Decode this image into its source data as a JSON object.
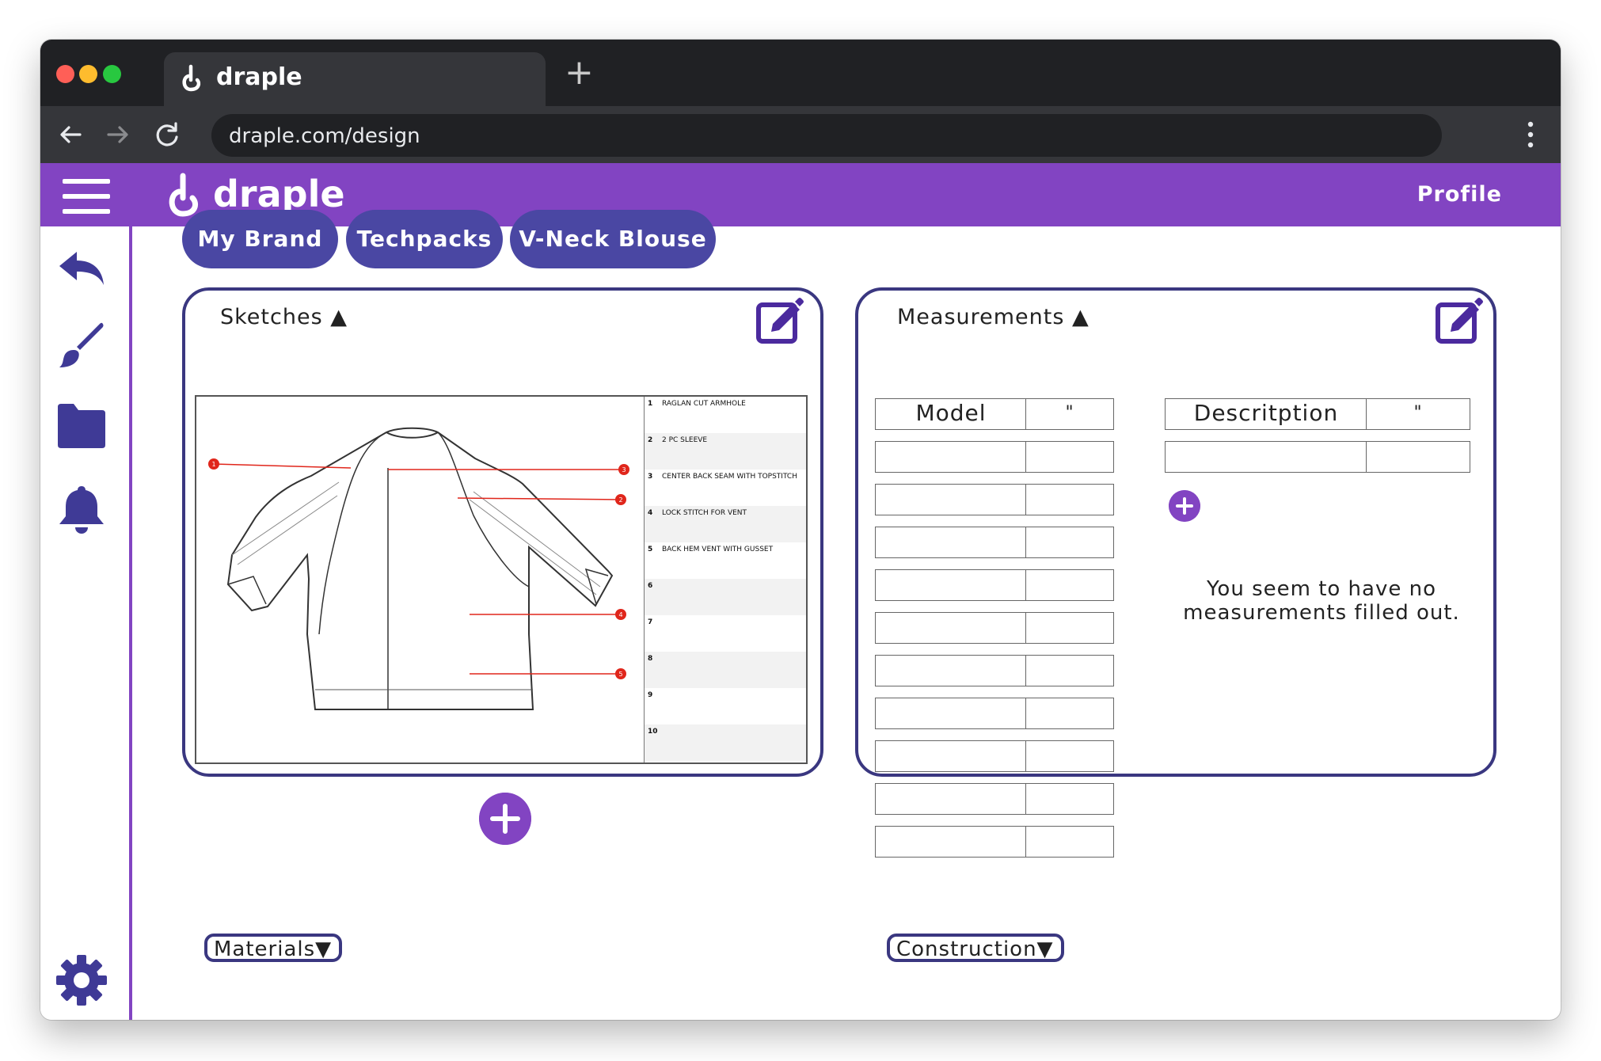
{
  "browser": {
    "tab_title": "draple",
    "new_tab_label": "+",
    "url": "draple.com/design"
  },
  "app": {
    "name": "draple",
    "profile_label": "Profile"
  },
  "breadcrumbs": [
    {
      "label": "My Brand"
    },
    {
      "label": "Techpacks"
    },
    {
      "label": "V-Neck Blouse"
    }
  ],
  "sketches": {
    "title": "Sketches",
    "callouts": [
      {
        "num": "1",
        "text": "RAGLAN CUT ARMHOLE"
      },
      {
        "num": "2",
        "text": "2 PC SLEEVE"
      },
      {
        "num": "3",
        "text": "CENTER BACK SEAM WITH TOPSTITCH"
      },
      {
        "num": "4",
        "text": "LOCK STITCH FOR VENT"
      },
      {
        "num": "5",
        "text": "BACK HEM VENT WITH GUSSET"
      },
      {
        "num": "6",
        "text": ""
      },
      {
        "num": "7",
        "text": ""
      },
      {
        "num": "8",
        "text": ""
      },
      {
        "num": "9",
        "text": ""
      },
      {
        "num": "10",
        "text": ""
      }
    ]
  },
  "measurements": {
    "title": "Measurements",
    "model_table": {
      "col1": "Model",
      "col2": "\""
    },
    "description_table": {
      "col1": "Descritption",
      "col2": "\""
    },
    "empty_message": "You seem to have no measurements filled out."
  },
  "sections": {
    "materials": "Materials",
    "construction": "Construction"
  },
  "colors": {
    "brand_purple": "#8244c2",
    "chip_indigo": "#4a47a3",
    "icon_indigo": "#3f3a96",
    "card_border": "#3a3780",
    "callout_red": "#e0261b"
  }
}
